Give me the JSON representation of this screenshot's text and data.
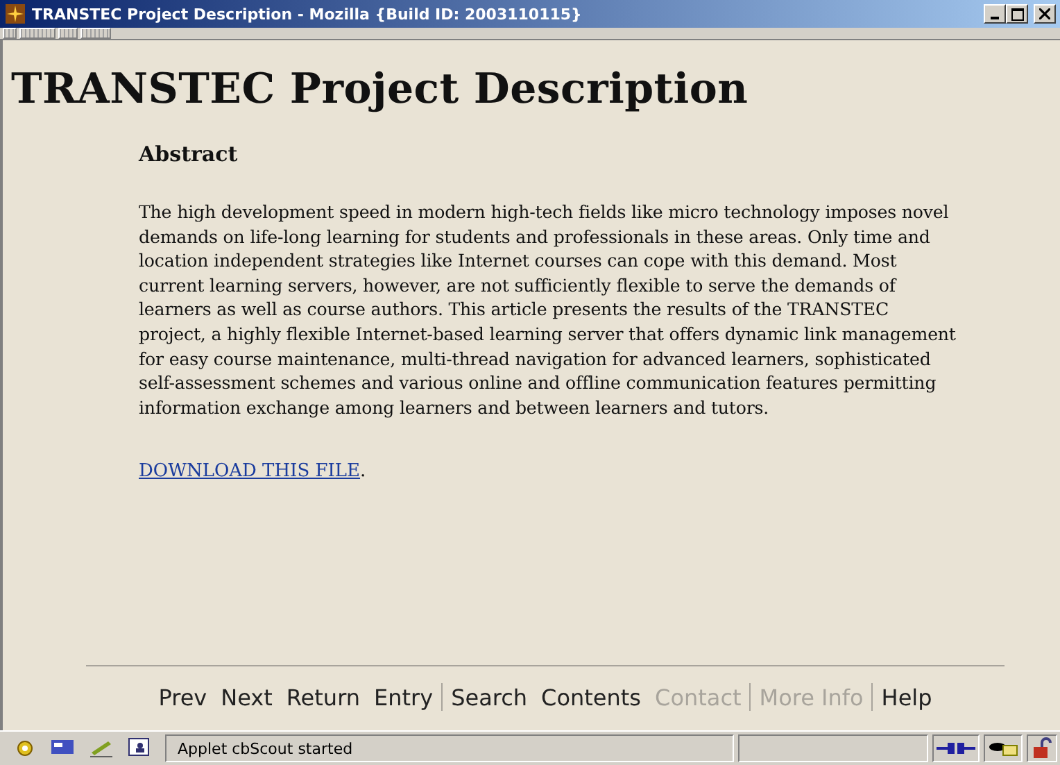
{
  "window": {
    "title": "TRANSTEC Project Description - Mozilla {Build ID: 2003110115}"
  },
  "page": {
    "heading": "TRANSTEC Project Description",
    "section_title": "Abstract",
    "abstract": "The high development speed in modern high-tech fields like micro technology imposes novel demands on life-long learning for students and professionals in these areas. Only time and location independent strategies like Internet courses can cope with this demand. Most current learning servers, however, are not sufficiently flexible to serve the demands of learners as well as course authors. This article presents the results of the TRANSTEC project, a highly flexible Internet-based learning server that offers dynamic link management for easy course maintenance, multi-thread navigation for advanced learners, sophisticated self-assessment schemes and various online and offline communication features permitting information exchange among learners and between learners and tutors.",
    "download_link": "DOWNLOAD THIS FILE",
    "download_suffix": "."
  },
  "nav": [
    {
      "kind": "link",
      "label": "Prev",
      "disabled": false
    },
    {
      "kind": "link",
      "label": "Next",
      "disabled": false
    },
    {
      "kind": "link",
      "label": "Return",
      "disabled": false
    },
    {
      "kind": "link",
      "label": "Entry",
      "disabled": false
    },
    {
      "kind": "divider"
    },
    {
      "kind": "link",
      "label": "Search",
      "disabled": false
    },
    {
      "kind": "link",
      "label": "Contents",
      "disabled": false
    },
    {
      "kind": "link",
      "label": "Contact",
      "disabled": true
    },
    {
      "kind": "divider"
    },
    {
      "kind": "link",
      "label": "More Info",
      "disabled": true
    },
    {
      "kind": "divider"
    },
    {
      "kind": "link",
      "label": "Help",
      "disabled": false
    }
  ],
  "status_bar": {
    "message": "Applet cbScout started"
  }
}
